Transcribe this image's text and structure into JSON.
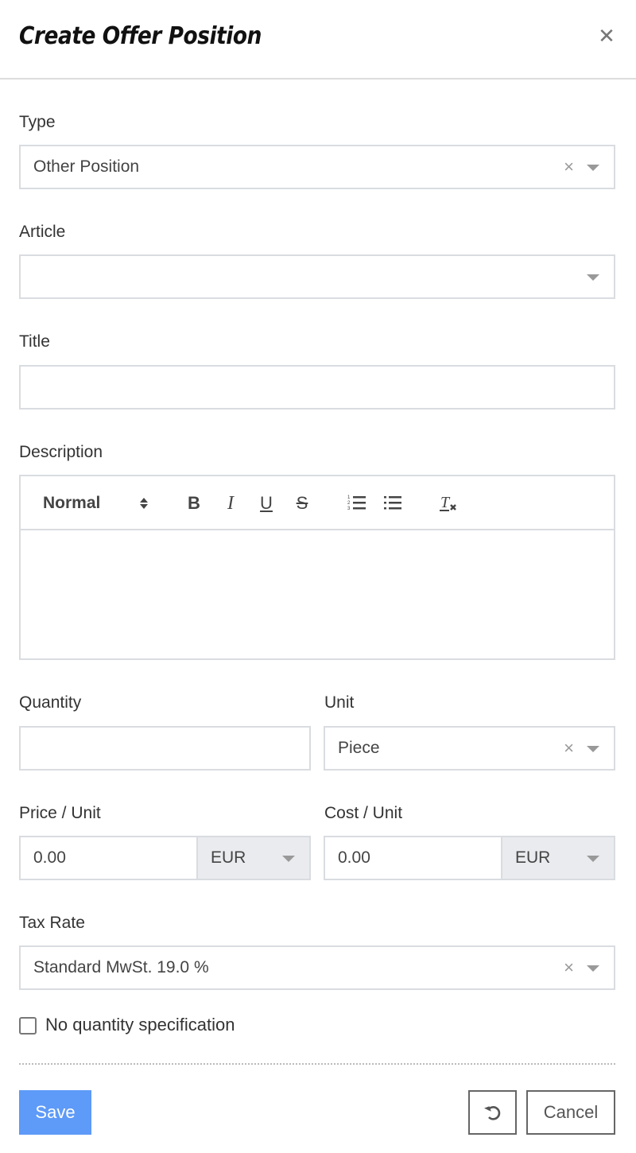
{
  "dialog": {
    "title": "Create Offer Position",
    "close_icon": "close-icon"
  },
  "form": {
    "type": {
      "label": "Type",
      "value": "Other Position",
      "clear_glyph": "×"
    },
    "article": {
      "label": "Article",
      "value": ""
    },
    "title": {
      "label": "Title",
      "value": ""
    },
    "description": {
      "label": "Description",
      "toolbar": {
        "format": "Normal",
        "bold": "B",
        "italic": "I",
        "underline": "U",
        "strike": "S",
        "clean": "T"
      },
      "value": ""
    },
    "quantity": {
      "label": "Quantity",
      "value": ""
    },
    "unit": {
      "label": "Unit",
      "value": "Piece",
      "clear_glyph": "×"
    },
    "price_unit": {
      "label": "Price / Unit",
      "value": "0.00",
      "currency": "EUR"
    },
    "cost_unit": {
      "label": "Cost / Unit",
      "value": "0.00",
      "currency": "EUR"
    },
    "tax_rate": {
      "label": "Tax Rate",
      "value": "Standard MwSt. 19.0 %",
      "clear_glyph": "×"
    },
    "no_quantity": {
      "label": "No quantity specification",
      "checked": false
    }
  },
  "footer": {
    "save": "Save",
    "cancel": "Cancel"
  },
  "colors": {
    "primary": "#5e9af7",
    "border": "#d9dce0",
    "addon_bg": "#e9ebee"
  }
}
